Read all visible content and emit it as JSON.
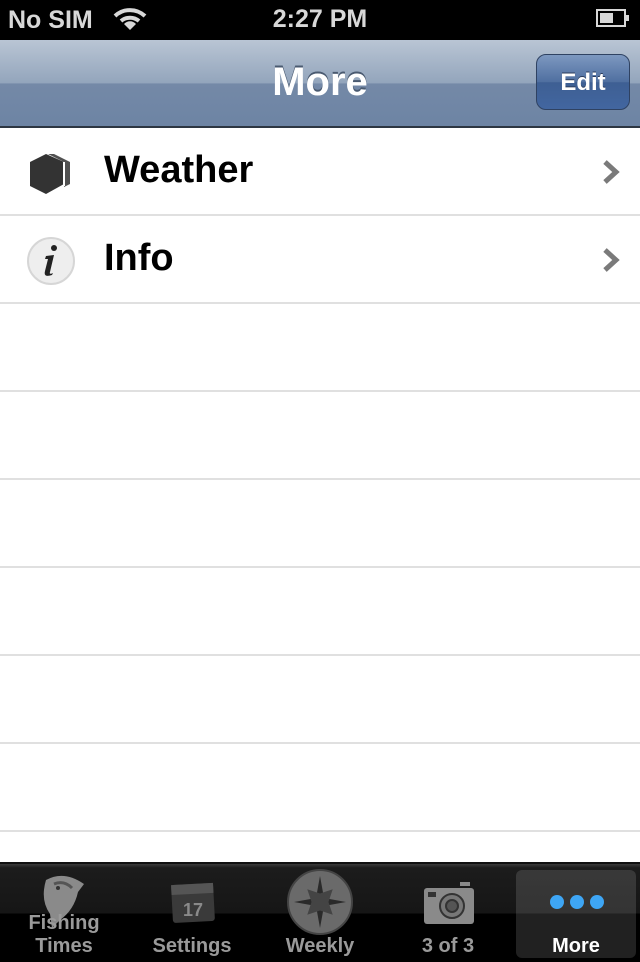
{
  "status_bar": {
    "carrier": "No SIM",
    "time": "2:27 PM",
    "battery_level": 0.5
  },
  "nav": {
    "title": "More",
    "edit_label": "Edit"
  },
  "list": {
    "items": [
      {
        "label": "Weather",
        "icon": "hexagon-icon"
      },
      {
        "label": "Info",
        "icon": "info-icon"
      }
    ]
  },
  "tabbar": {
    "tabs": [
      {
        "label": "Fishing Times",
        "icon": "fish-icon",
        "active": false
      },
      {
        "label": "Settings",
        "icon": "calendar-icon",
        "active": false
      },
      {
        "label": "Weekly",
        "icon": "compass-icon",
        "active": false
      },
      {
        "label": "3 of 3",
        "icon": "camera-icon",
        "active": false
      },
      {
        "label": "More",
        "icon": "more-dots-icon",
        "active": true
      }
    ],
    "calendar_day": "17",
    "accent": "#3ea6f5"
  }
}
